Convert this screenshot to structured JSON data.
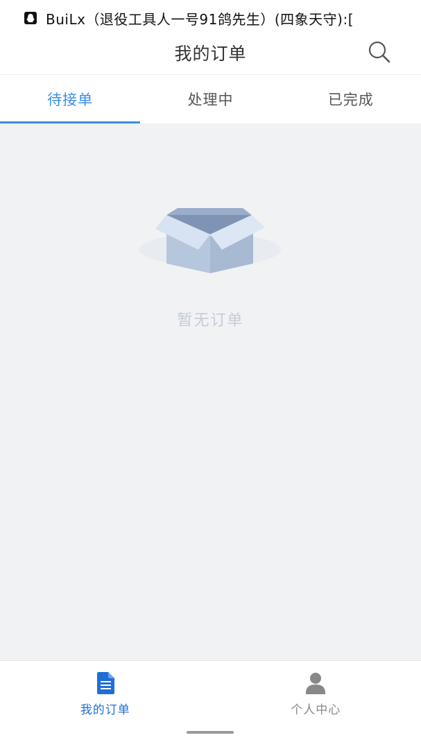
{
  "status_bar": {
    "notification_icon": "qq-penguin-icon",
    "notification_text": "BuiLx（退役工具人一号91鸽先生）(四象天守):["
  },
  "header": {
    "title": "我的订单",
    "search_icon": "search-icon"
  },
  "tabs": [
    {
      "label": "待接单",
      "active": true
    },
    {
      "label": "处理中",
      "active": false
    },
    {
      "label": "已完成",
      "active": false
    }
  ],
  "empty_state": {
    "icon": "empty-box-icon",
    "text": "暂无订单"
  },
  "bottom_nav": [
    {
      "label": "我的订单",
      "icon": "document-icon",
      "active": true
    },
    {
      "label": "个人中心",
      "icon": "person-icon",
      "active": false
    }
  ],
  "colors": {
    "accent": "#3a8ee6",
    "nav_active": "#1f6fd6",
    "content_bg": "#f1f2f4",
    "empty_text": "#c4cbd9"
  }
}
